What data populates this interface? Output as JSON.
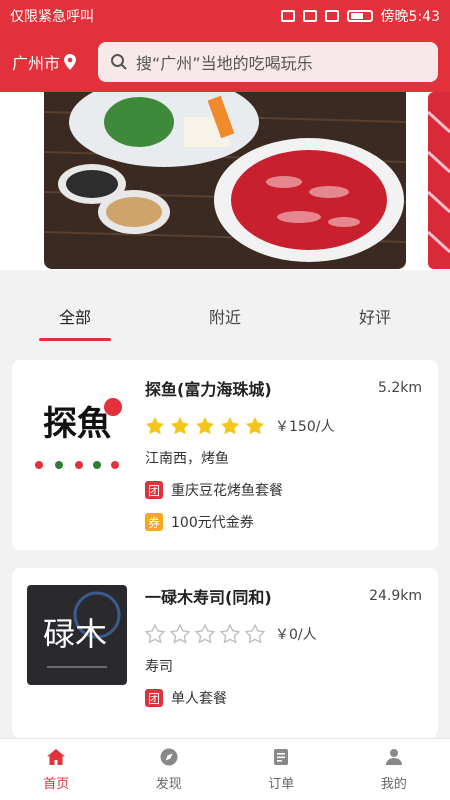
{
  "statusbar": {
    "left_text": "仅限紧急呼叫",
    "right_text": "傍晚5:43"
  },
  "header": {
    "city": "广州市",
    "search_placeholder": "搜“广州”当地的吃喝玩乐"
  },
  "tabs": [
    {
      "label": "全部",
      "active": true
    },
    {
      "label": "附近",
      "active": false
    },
    {
      "label": "好评",
      "active": false
    }
  ],
  "shops": [
    {
      "name": "探鱼(富力海珠城)",
      "distance": "5.2km",
      "rating": 5,
      "price": "￥150/人",
      "tags": "江南西，烤鱼",
      "deals": [
        {
          "badge": "团",
          "text": "重庆豆花烤鱼套餐",
          "color": "#e2313b"
        },
        {
          "badge": "券",
          "text": "100元代金券",
          "color": "#f5a623"
        }
      ],
      "logo_text": "探魚"
    },
    {
      "name": "一碌木寿司(同和)",
      "distance": "24.9km",
      "rating": 0,
      "price": "￥0/人",
      "tags": "寿司",
      "deals": [
        {
          "badge": "团",
          "text": "单人套餐",
          "color": "#e2313b"
        }
      ],
      "logo_text": "碌木"
    }
  ],
  "bottom_nav": [
    {
      "label": "首页",
      "icon": "home-icon",
      "active": true
    },
    {
      "label": "发现",
      "icon": "compass-icon",
      "active": false
    },
    {
      "label": "订单",
      "icon": "order-icon",
      "active": false
    },
    {
      "label": "我的",
      "icon": "user-icon",
      "active": false
    }
  ],
  "colors": {
    "brand_red": "#e2313b",
    "star_gold": "#f5c518",
    "coupon_orange": "#f5a623"
  }
}
